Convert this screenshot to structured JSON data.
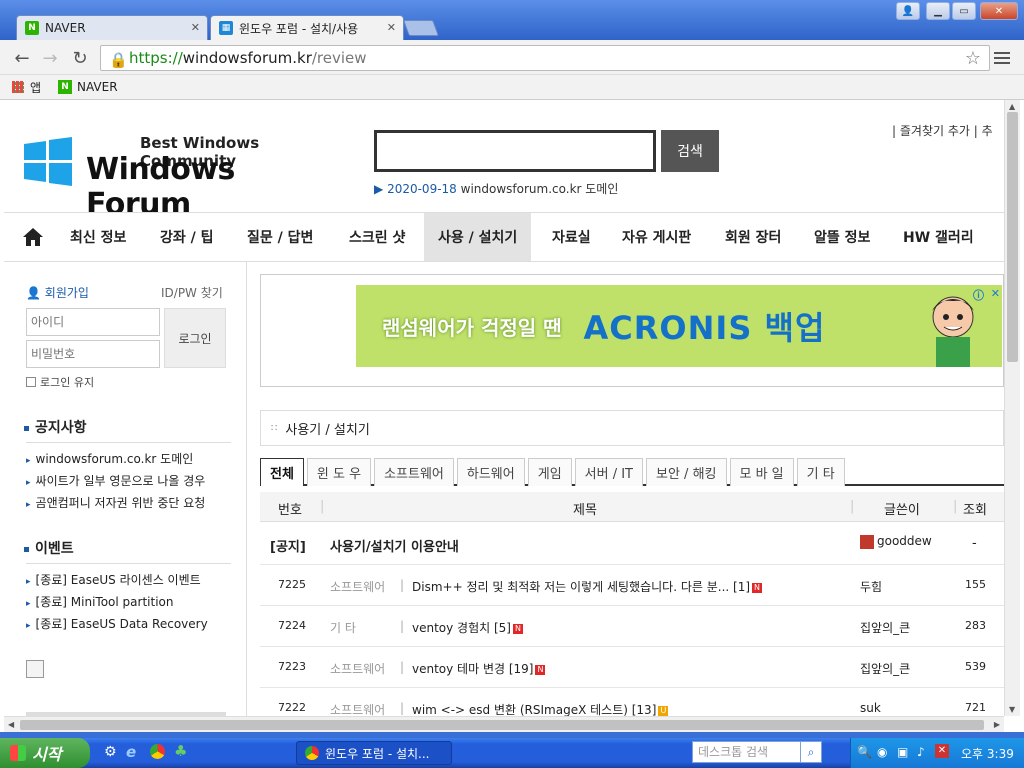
{
  "browser": {
    "tabs": [
      {
        "title": "NAVER",
        "active": false
      },
      {
        "title": "윈도우 포럼 - 설치/사용",
        "active": true
      }
    ],
    "url": {
      "scheme": "https://",
      "host": "windowsforum.kr",
      "path": "/review"
    },
    "bookmarks": [
      {
        "label": "앱"
      },
      {
        "label": "NAVER"
      }
    ]
  },
  "header": {
    "logo_tagline": "Best Windows Community",
    "logo_name": "Windows Forum",
    "search_button": "검색",
    "notice_date": "2020-09-18",
    "notice_text": "windowsforum.co.kr 도메인",
    "toplinks": "| 즐겨찾기 추가 | 추"
  },
  "nav": {
    "items": [
      {
        "label": "최신 정보"
      },
      {
        "label": "강좌 / 팁"
      },
      {
        "label": "질문 / 답변"
      },
      {
        "label": "스크린 샷"
      },
      {
        "label": "사용 / 설치기"
      },
      {
        "label": "자료실"
      },
      {
        "label": "자유 게시판"
      },
      {
        "label": "회원 장터"
      },
      {
        "label": "알뜰 정보"
      },
      {
        "label": "HW 갤러리"
      }
    ],
    "active": "사용 / 설치기"
  },
  "login": {
    "signup": "회원가입",
    "find": "ID/PW 찾기",
    "id_placeholder": "아이디",
    "pw_placeholder": "비밀번호",
    "login_button": "로그인",
    "keep_label": "로그인 유지"
  },
  "notices": {
    "title": "공지사항",
    "items": [
      "windowsforum.co.kr 도메인",
      "싸이트가 일부 영문으로 나올 경우",
      "곰앤컴퍼니 저자권 위반 중단 요청"
    ]
  },
  "events": {
    "title": "이벤트",
    "items": [
      "[종료] EaseUS 라이센스 이벤트",
      "[종료] MiniTool partition",
      "[종료] EaseUS Data Recovery"
    ]
  },
  "ad": {
    "text1": "랜섬웨어가 걱정일 땐",
    "text2": "ACRONIS 백업"
  },
  "board": {
    "heading": "사용기 / 설치기",
    "categories": [
      "전체",
      "윈 도 우",
      "소프트웨어",
      "하드웨어",
      "게임",
      "서버 / IT",
      "보안 / 해킹",
      "모 바 일",
      "기 타"
    ],
    "active_category": "전체",
    "columns": {
      "no": "번호",
      "title": "제목",
      "author": "글쓴이",
      "views": "조회"
    },
    "notice_row": {
      "no": "[공지]",
      "title": "사용기/설치기 이용안내",
      "author": "gooddew",
      "views": "-"
    },
    "rows": [
      {
        "no": "7225",
        "category": "소프트웨어",
        "title": "Dism++ 정리 및 최적화 저는 이렇게 세팅했습니다. 다른 분... [1]",
        "badge": "N",
        "author": "두힘",
        "views": "155"
      },
      {
        "no": "7224",
        "category": "기 타",
        "title": "ventoy 경험치 [5]",
        "badge": "N",
        "author": "집앞의_큰",
        "views": "283"
      },
      {
        "no": "7223",
        "category": "소프트웨어",
        "title": "ventoy 테마 변경 [19]",
        "badge": "N",
        "author": "집앞의_큰",
        "views": "539"
      },
      {
        "no": "7222",
        "category": "소프트웨어",
        "title": "wim <-> esd 변환 (RSImageX 테스트) [13]",
        "badge": "U",
        "author": "suk",
        "views": "721"
      }
    ]
  },
  "taskbar": {
    "start": "시작",
    "task": "윈도우 포럼 - 설치...",
    "search_placeholder": "데스크톱 검색",
    "clock": "오후 3:39"
  }
}
